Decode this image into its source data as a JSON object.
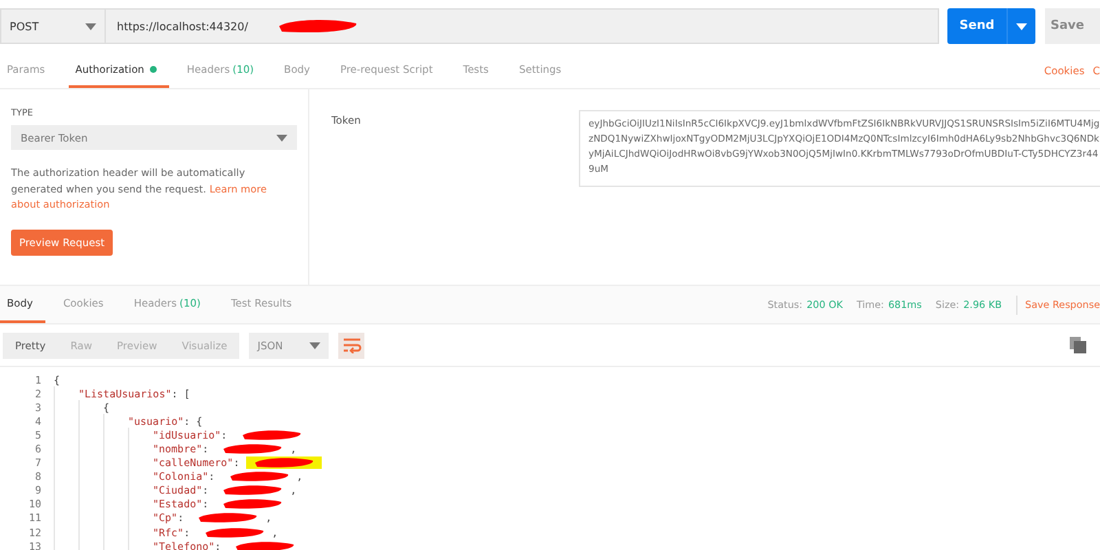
{
  "request": {
    "method": "POST",
    "url": "https://localhost:44320/",
    "url_redacted": true,
    "send": "Send",
    "save": "Save"
  },
  "request_tabs": [
    {
      "label": "Params",
      "selected": false
    },
    {
      "label": "Authorization",
      "selected": true,
      "dot": true
    },
    {
      "label": "Headers",
      "count": "(10)",
      "selected": false
    },
    {
      "label": "Body",
      "selected": false
    },
    {
      "label": "Pre-request Script",
      "selected": false
    },
    {
      "label": "Tests",
      "selected": false
    },
    {
      "label": "Settings",
      "selected": false
    }
  ],
  "request_links": [
    "Cookies",
    "C"
  ],
  "auth": {
    "type_label": "TYPE",
    "type": "Bearer Token",
    "help": "The authorization header will be automatically generated when you send the request. ",
    "help_link_lines": [
      "Learn more",
      "about authorization"
    ],
    "preview": "Preview Request",
    "token_label": "Token",
    "token": "eyJhbGciOiJIUzI1NiIsInR5cCI6IkpXVCJ9.eyJ1bmlxdWVfbmFtZSI6IkNBRkVURVJJQS1SRUNSRSIsIm5iZiI6MTU4MjgzNDQ1NywiZXhwIjoxNTgyODM2MjU3LCJpYXQiOjE1ODI4MzQ0NTcsImlzcyI6Imh0dHA6Ly9sb2NhbGhvc3Q6NDkyMjAiLCJhdWQiOiJodHRwOi8vbG9jYWxob3N0OjQ5MjIwIn0.KKrbmTMLWs7793oDrOfmUBDIuT-CTy5DHCYZ3r449uM"
  },
  "response_tabs": [
    {
      "label": "Body",
      "selected": true
    },
    {
      "label": "Cookies",
      "selected": false
    },
    {
      "label": "Headers",
      "count": "(10)",
      "selected": false
    },
    {
      "label": "Test Results",
      "selected": false
    }
  ],
  "response_meta": [
    {
      "label": "Status:",
      "value": "200 OK"
    },
    {
      "label": "Time:",
      "value": "681ms"
    },
    {
      "label": "Size:",
      "value": "2.96 KB"
    }
  ],
  "save_response": "Save Response",
  "view_modes": [
    {
      "label": "Pretty",
      "selected": true
    },
    {
      "label": "Raw",
      "selected": false
    },
    {
      "label": "Preview",
      "selected": false
    },
    {
      "label": "Visualize",
      "selected": false
    }
  ],
  "format": "JSON",
  "code": [
    {
      "n": "1",
      "text": "{",
      "kind": "punct",
      "children": [
        {
          "n": "2",
          "key": "\"ListaUsuarios\"",
          "text": ": [",
          "kind": "key",
          "children": [
            {
              "n": "3",
              "text": "{",
              "kind": "punct",
              "children": [
                {
                  "n": "4",
                  "key": "\"usuario\"",
                  "text": ": {",
                  "kind": "key",
                  "children": [
                    {
                      "n": "5",
                      "key": "\"idUsuario\"",
                      "text": ": ",
                      "kind": "key",
                      "redacted": true
                    },
                    {
                      "n": "6",
                      "key": "\"nombre\"",
                      "text": ": ",
                      "kind": "key",
                      "redacted": true,
                      "after": ","
                    },
                    {
                      "n": "7",
                      "key": "\"calleNumero\"",
                      "text": ": ",
                      "kind": "key",
                      "redacted": true,
                      "highlighted": true
                    },
                    {
                      "n": "8",
                      "key": "\"Colonia\"",
                      "text": ": ",
                      "kind": "key",
                      "redacted": true,
                      "after": ","
                    },
                    {
                      "n": "9",
                      "key": "\"Ciudad\"",
                      "text": ": ",
                      "kind": "key",
                      "redacted": true,
                      "after": ","
                    },
                    {
                      "n": "10",
                      "key": "\"Estado\"",
                      "text": ": ",
                      "kind": "key",
                      "redacted": true
                    },
                    {
                      "n": "11",
                      "key": "\"Cp\"",
                      "text": ": ",
                      "kind": "key",
                      "redacted": true,
                      "after": ","
                    },
                    {
                      "n": "12",
                      "key": "\"Rfc\"",
                      "text": ": ",
                      "kind": "key",
                      "redacted": true,
                      "after": ","
                    },
                    {
                      "n": "13",
                      "key": "\"Telefono\"",
                      "text": ": ",
                      "kind": "key",
                      "redacted": true
                    }
                  ]
                }
              ]
            }
          ]
        }
      ]
    }
  ]
}
